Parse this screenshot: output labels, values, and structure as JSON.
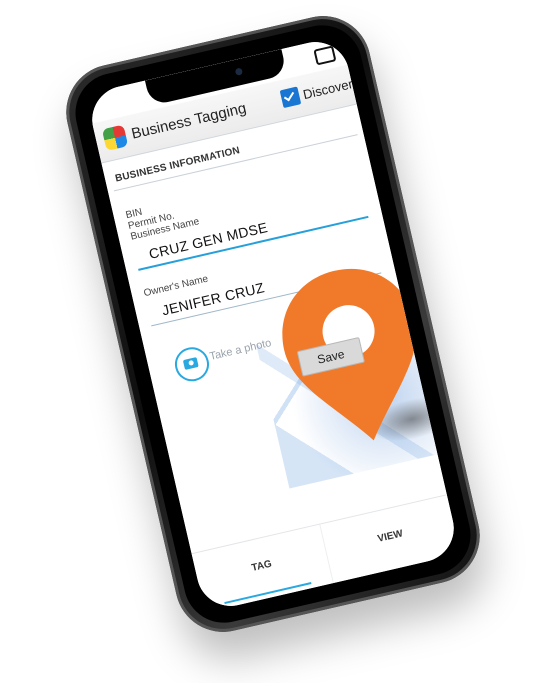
{
  "app": {
    "title": "Business Tagging",
    "discover_label": "Discover",
    "discover_checked": true
  },
  "form": {
    "section_title": "BUSINESS INFORMATION",
    "bin_label": "BIN",
    "permit_label": "Permit No.",
    "business_name_label": "Business Name",
    "business_name_value": "CRUZ GEN MDSE",
    "owner_label": "Owner's Name",
    "owner_value": "JENIFER CRUZ",
    "photo_label": "Take a photo",
    "save_label": "Save"
  },
  "tabs": [
    {
      "label": "TAG",
      "selected": true
    },
    {
      "label": "VIEW",
      "selected": false
    }
  ],
  "colors": {
    "pin": "#f07a2a",
    "accent": "#29a9e0",
    "checkbox": "#1976d2"
  }
}
